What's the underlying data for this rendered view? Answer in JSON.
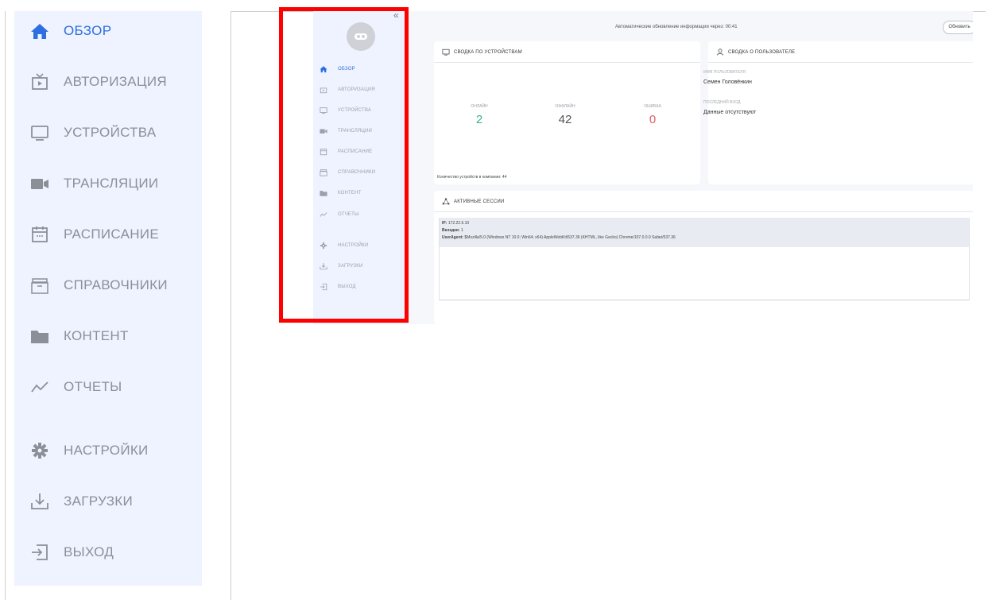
{
  "sidebar": {
    "items": [
      {
        "label": "ОБЗОР",
        "icon": "home-icon",
        "active": true
      },
      {
        "label": "АВТОРИЗАЦИЯ",
        "icon": "tv-icon",
        "active": false
      },
      {
        "label": "УСТРОЙСТВА",
        "icon": "monitor-icon",
        "active": false
      },
      {
        "label": "ТРАНСЛЯЦИИ",
        "icon": "video-camera-icon",
        "active": false
      },
      {
        "label": "РАСПИСАНИЕ",
        "icon": "calendar-icon",
        "active": false
      },
      {
        "label": "СПРАВОЧНИКИ",
        "icon": "archive-icon",
        "active": false
      },
      {
        "label": "КОНТЕНТ",
        "icon": "folder-icon",
        "active": false
      },
      {
        "label": "ОТЧЕТЫ",
        "icon": "chart-line-icon",
        "active": false
      },
      {
        "label": "НАСТРОЙКИ",
        "icon": "gear-icon",
        "active": false
      },
      {
        "label": "ЗАГРУЗКИ",
        "icon": "download-icon",
        "active": false
      },
      {
        "label": "ВЫХОД",
        "icon": "logout-icon",
        "active": false
      }
    ]
  },
  "screenshot": {
    "collapse": "«",
    "topbar": {
      "auto_update": "Автоматические обновление информации через: 00:41",
      "refresh": "Обновить"
    },
    "devices_card": {
      "title": "СВОДКА ПО УСТРОЙСТВАМ",
      "stats": [
        {
          "label": "ОНЛАЙН",
          "value": "2",
          "color": "#3bb48c"
        },
        {
          "label": "ОФФЛАЙН",
          "value": "42",
          "color": "#555555"
        },
        {
          "label": "ОШИБКА",
          "value": "0",
          "color": "#e0605e"
        }
      ],
      "footer": "Количество устройств в компании: 44"
    },
    "user_card": {
      "title": "СВОДКА О ПОЛЬЗОВАТЕЛЕ",
      "username_label": "ИМЯ ПОЛЬЗОВАТЕЛЯ",
      "username": "Семен Головёнкин",
      "last_login_label": "ПОСЛЕДНИЙ ВХОД",
      "last_login": "Данные отсутствуют"
    },
    "sessions_card": {
      "title": "АКТИВНЫЕ СЕССИИ",
      "ip_label": "IP:",
      "ip": "172.22.6.10",
      "tabs_label": "Вкладки:",
      "tabs": "1",
      "ua_label": "UserAgent:",
      "ua": "$Mozilla/5.0 (Windows NT 10.0; Win64; x64) AppleWebKit/537.36 (KHTML, like Gecko) Chrome/107.0.0.0 Safari/537.36"
    }
  },
  "colors": {
    "accent": "#2d6ee0",
    "sidebar_bg": "#eef3ff",
    "highlight": "#ff0000"
  }
}
